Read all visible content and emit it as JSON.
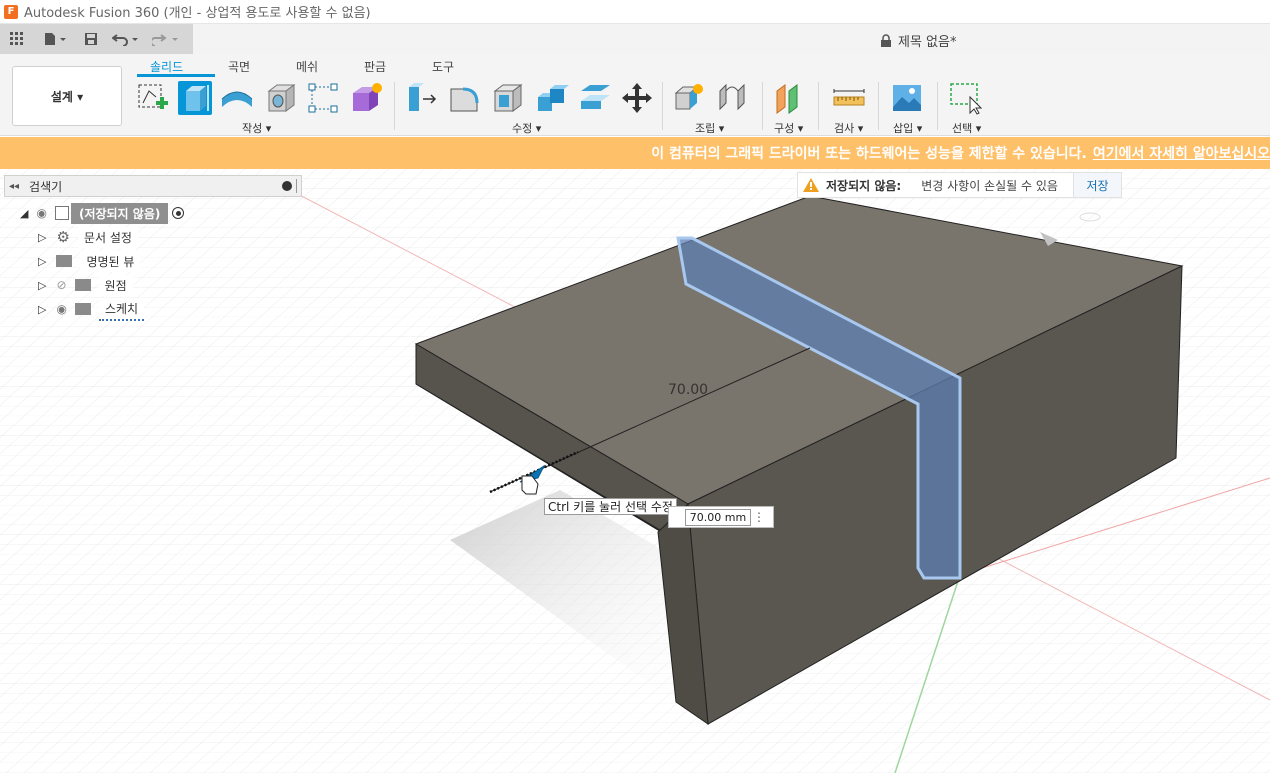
{
  "window": {
    "title": "Autodesk Fusion 360 (개인 - 상업적 용도로 사용할 수 없음)",
    "doc_title": "제목 없음*"
  },
  "workspace": {
    "label": "설계 ▾"
  },
  "tabs": [
    "솔리드",
    "곡면",
    "메쉬",
    "판금",
    "도구"
  ],
  "groups": {
    "create": "작성 ▾",
    "modify": "수정 ▾",
    "assemble": "조립 ▾",
    "construct": "구성 ▾",
    "inspect": "검사 ▾",
    "insert": "삽입 ▾",
    "select": "선택 ▾"
  },
  "banner": {
    "text": "이 컴퓨터의 그래픽 드라이버 또는 하드웨어는 성능을 제한할 수 있습니다.",
    "link": "여기에서 자세히 알아보십시오"
  },
  "browser": {
    "title": "검색기",
    "root": "(저장되지 않음)",
    "items": [
      "문서 설정",
      "명명된 뷰",
      "원점",
      "스케치"
    ]
  },
  "unsaved": {
    "label": "저장되지 않음:",
    "message": "변경 사항이 손실될 수 있음",
    "save": "저장"
  },
  "viewport": {
    "dimension_label": "70.00",
    "tooltip": "Ctrl 키를 눌러 선택 수정",
    "dimension_input": "70.00 mm"
  },
  "colors": {
    "accent": "#0696d7",
    "banner": "#ffc06a",
    "body_top": "#7a756c",
    "body_side": "#5a5650",
    "selection": "#5f7fb3"
  }
}
